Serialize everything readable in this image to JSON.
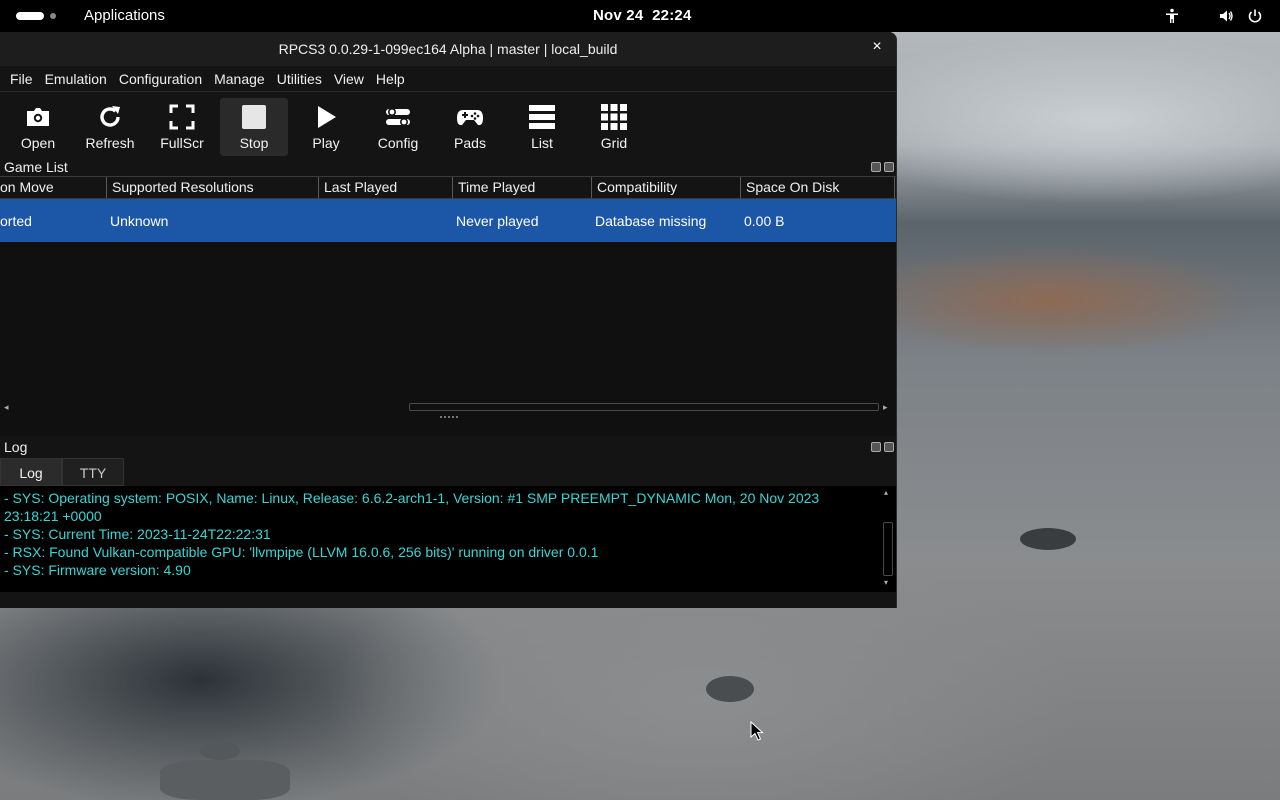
{
  "topbar": {
    "applications": "Applications",
    "date": "Nov 24",
    "time": "22:24"
  },
  "window": {
    "title": "RPCS3 0.0.29-1-099ec164 Alpha | master | local_build",
    "close_glyph": "×"
  },
  "menu": [
    "File",
    "Emulation",
    "Configuration",
    "Manage",
    "Utilities",
    "View",
    "Help"
  ],
  "toolbar": [
    {
      "label": "Open",
      "icon": "folder-open-icon"
    },
    {
      "label": "Refresh",
      "icon": "refresh-icon"
    },
    {
      "label": "FullScr",
      "icon": "fullscreen-icon"
    },
    {
      "label": "Stop",
      "icon": "stop-icon"
    },
    {
      "label": "Play",
      "icon": "play-icon"
    },
    {
      "label": "Config",
      "icon": "config-icon"
    },
    {
      "label": "Pads",
      "icon": "gamepad-icon"
    },
    {
      "label": "List",
      "icon": "list-icon"
    },
    {
      "label": "Grid",
      "icon": "grid-icon"
    }
  ],
  "game_list": {
    "title": "Game List",
    "columns": [
      "on Move",
      "Supported Resolutions",
      "Last Played",
      "Time Played",
      "Compatibility",
      "Space On Disk"
    ],
    "rows": [
      [
        "orted",
        "Unknown",
        "",
        "Never played",
        "Database missing",
        "0.00 B"
      ]
    ]
  },
  "log": {
    "title": "Log",
    "tabs": [
      "Log",
      "TTY"
    ],
    "lines": [
      "- SYS: Operating system: POSIX, Name: Linux, Release: 6.6.2-arch1-1, Version: #1 SMP PREEMPT_DYNAMIC Mon, 20 Nov 2023",
      "23:18:21 +0000",
      "- SYS: Current Time: 2023-11-24T22:22:31",
      "- RSX: Found Vulkan-compatible GPU: 'llvmpipe (LLVM 16.0.6, 256 bits)' running on driver 0.0.1",
      "- SYS: Firmware version: 4.90"
    ]
  },
  "colors": {
    "selection": "#1c56a6",
    "log_text": "#36d6d6"
  }
}
